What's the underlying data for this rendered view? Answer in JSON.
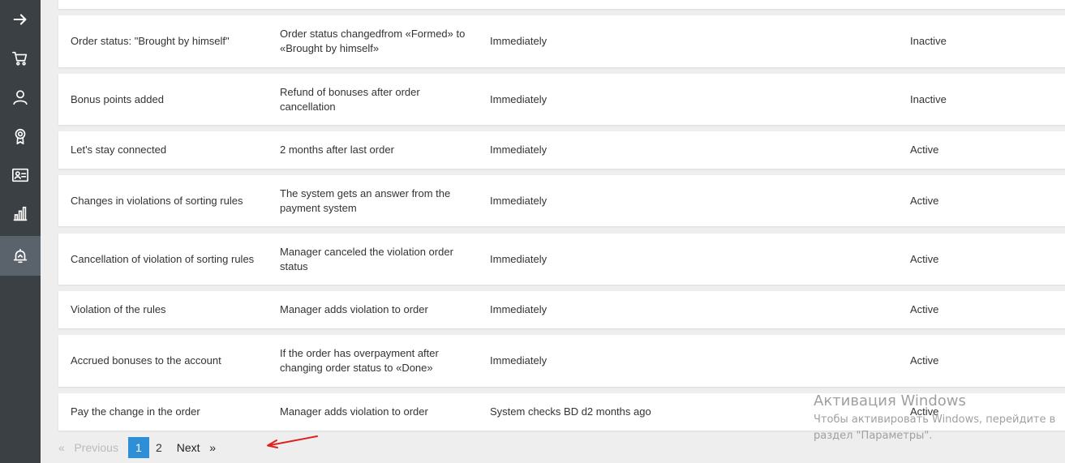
{
  "sidebar": {
    "icons": [
      "arrow-right-icon",
      "cart-icon",
      "user-icon",
      "award-icon",
      "contact-card-icon",
      "bar-chart-icon",
      "bell-icon"
    ],
    "active_index": 6
  },
  "rows": [
    {
      "name": "Order status: \"Brought by himself\"",
      "trigger": "Order status changedfrom «Formed» to «Brought by himself»",
      "timing": "Immediately",
      "status": "Inactive"
    },
    {
      "name": "Bonus points added",
      "trigger": "Refund of bonuses after order cancellation",
      "timing": "Immediately",
      "status": "Inactive"
    },
    {
      "name": "Let's stay connected",
      "trigger": "2 months after last order",
      "timing": "Immediately",
      "status": "Active"
    },
    {
      "name": "Changes in violations of sorting rules",
      "trigger": "The system gets an answer from the payment system",
      "timing": "Immediately",
      "status": "Active"
    },
    {
      "name": "Cancellation of violation of sorting rules",
      "trigger": "Manager canceled the violation order status",
      "timing": "Immediately",
      "status": "Active"
    },
    {
      "name": "Violation of the rules",
      "trigger": "Manager adds violation to order",
      "timing": "Immediately",
      "status": "Active"
    },
    {
      "name": "Accrued bonuses to the account",
      "trigger": "If the order has overpayment after changing order status to «Done»",
      "timing": "Immediately",
      "status": "Active"
    },
    {
      "name": "Pay the change in the order",
      "trigger": "Manager adds violation to order",
      "timing": "System checks BD d2 months ago",
      "status": "Active"
    }
  ],
  "pagination": {
    "prev_arrow": "«",
    "prev_label": "Previous",
    "pages": [
      "1",
      "2"
    ],
    "current": "1",
    "next_label": "Next",
    "next_arrow": "»"
  },
  "watermark": {
    "title": "Активация Windows",
    "line1": "Чтобы активировать Windows, перейдите в",
    "line2": "раздел \"Параметры\"."
  },
  "colors": {
    "sidebar_bg": "#3b4045",
    "sidebar_active": "#5a636c",
    "page_bg": "#eeeeee",
    "current_page": "#2f8fd6",
    "annotation_arrow": "#e02020"
  }
}
